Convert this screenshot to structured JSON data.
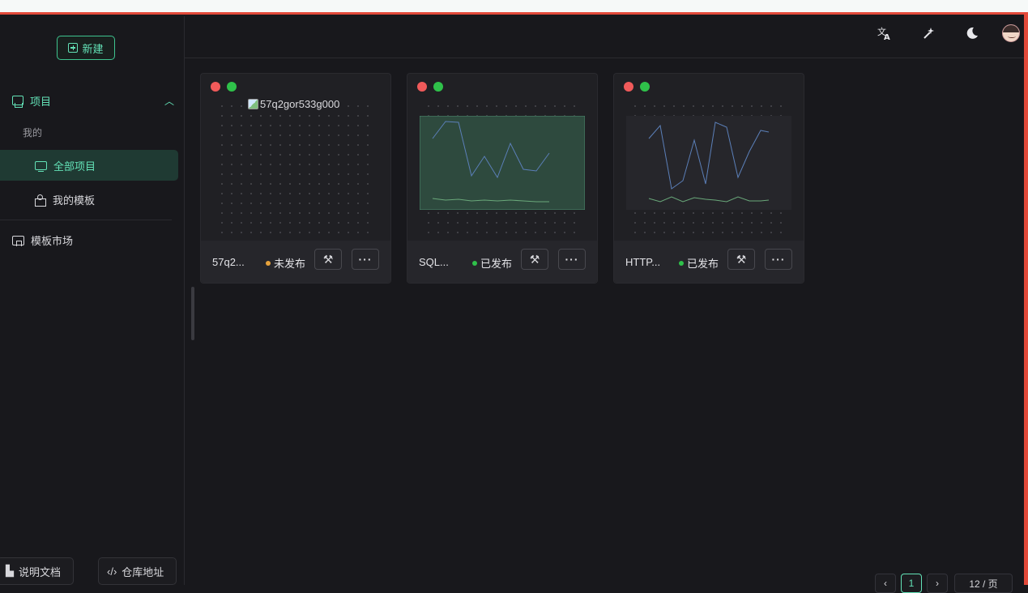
{
  "sidebar": {
    "new_label": "新建",
    "project_label": "项目",
    "mine_label": "我的",
    "all_projects_label": "全部项目",
    "my_templates_label": "我的模板",
    "template_market_label": "模板市场",
    "docs_label": "说明文档",
    "repo_label": "仓库地址"
  },
  "topbar": {
    "icons": [
      "translate-icon",
      "magic-wand-icon",
      "moon-icon",
      "avatar"
    ]
  },
  "projects": [
    {
      "name": "57q2...",
      "status": "未发布",
      "status_color": "#e6a23c",
      "preview_alt": "57q2gor533g000",
      "preview": "broken-image"
    },
    {
      "name": "SQL...",
      "status": "已发布",
      "status_color": "#2fc14a",
      "preview": "line-chart-green"
    },
    {
      "name": "HTTP...",
      "status": "已发布",
      "status_color": "#2fc14a",
      "preview": "line-chart-dark"
    }
  ],
  "pager": {
    "current_page": "1",
    "page_size": "12 / 页"
  },
  "colors": {
    "accent": "#63e2b7",
    "background": "#18181c",
    "card": "#202024"
  }
}
